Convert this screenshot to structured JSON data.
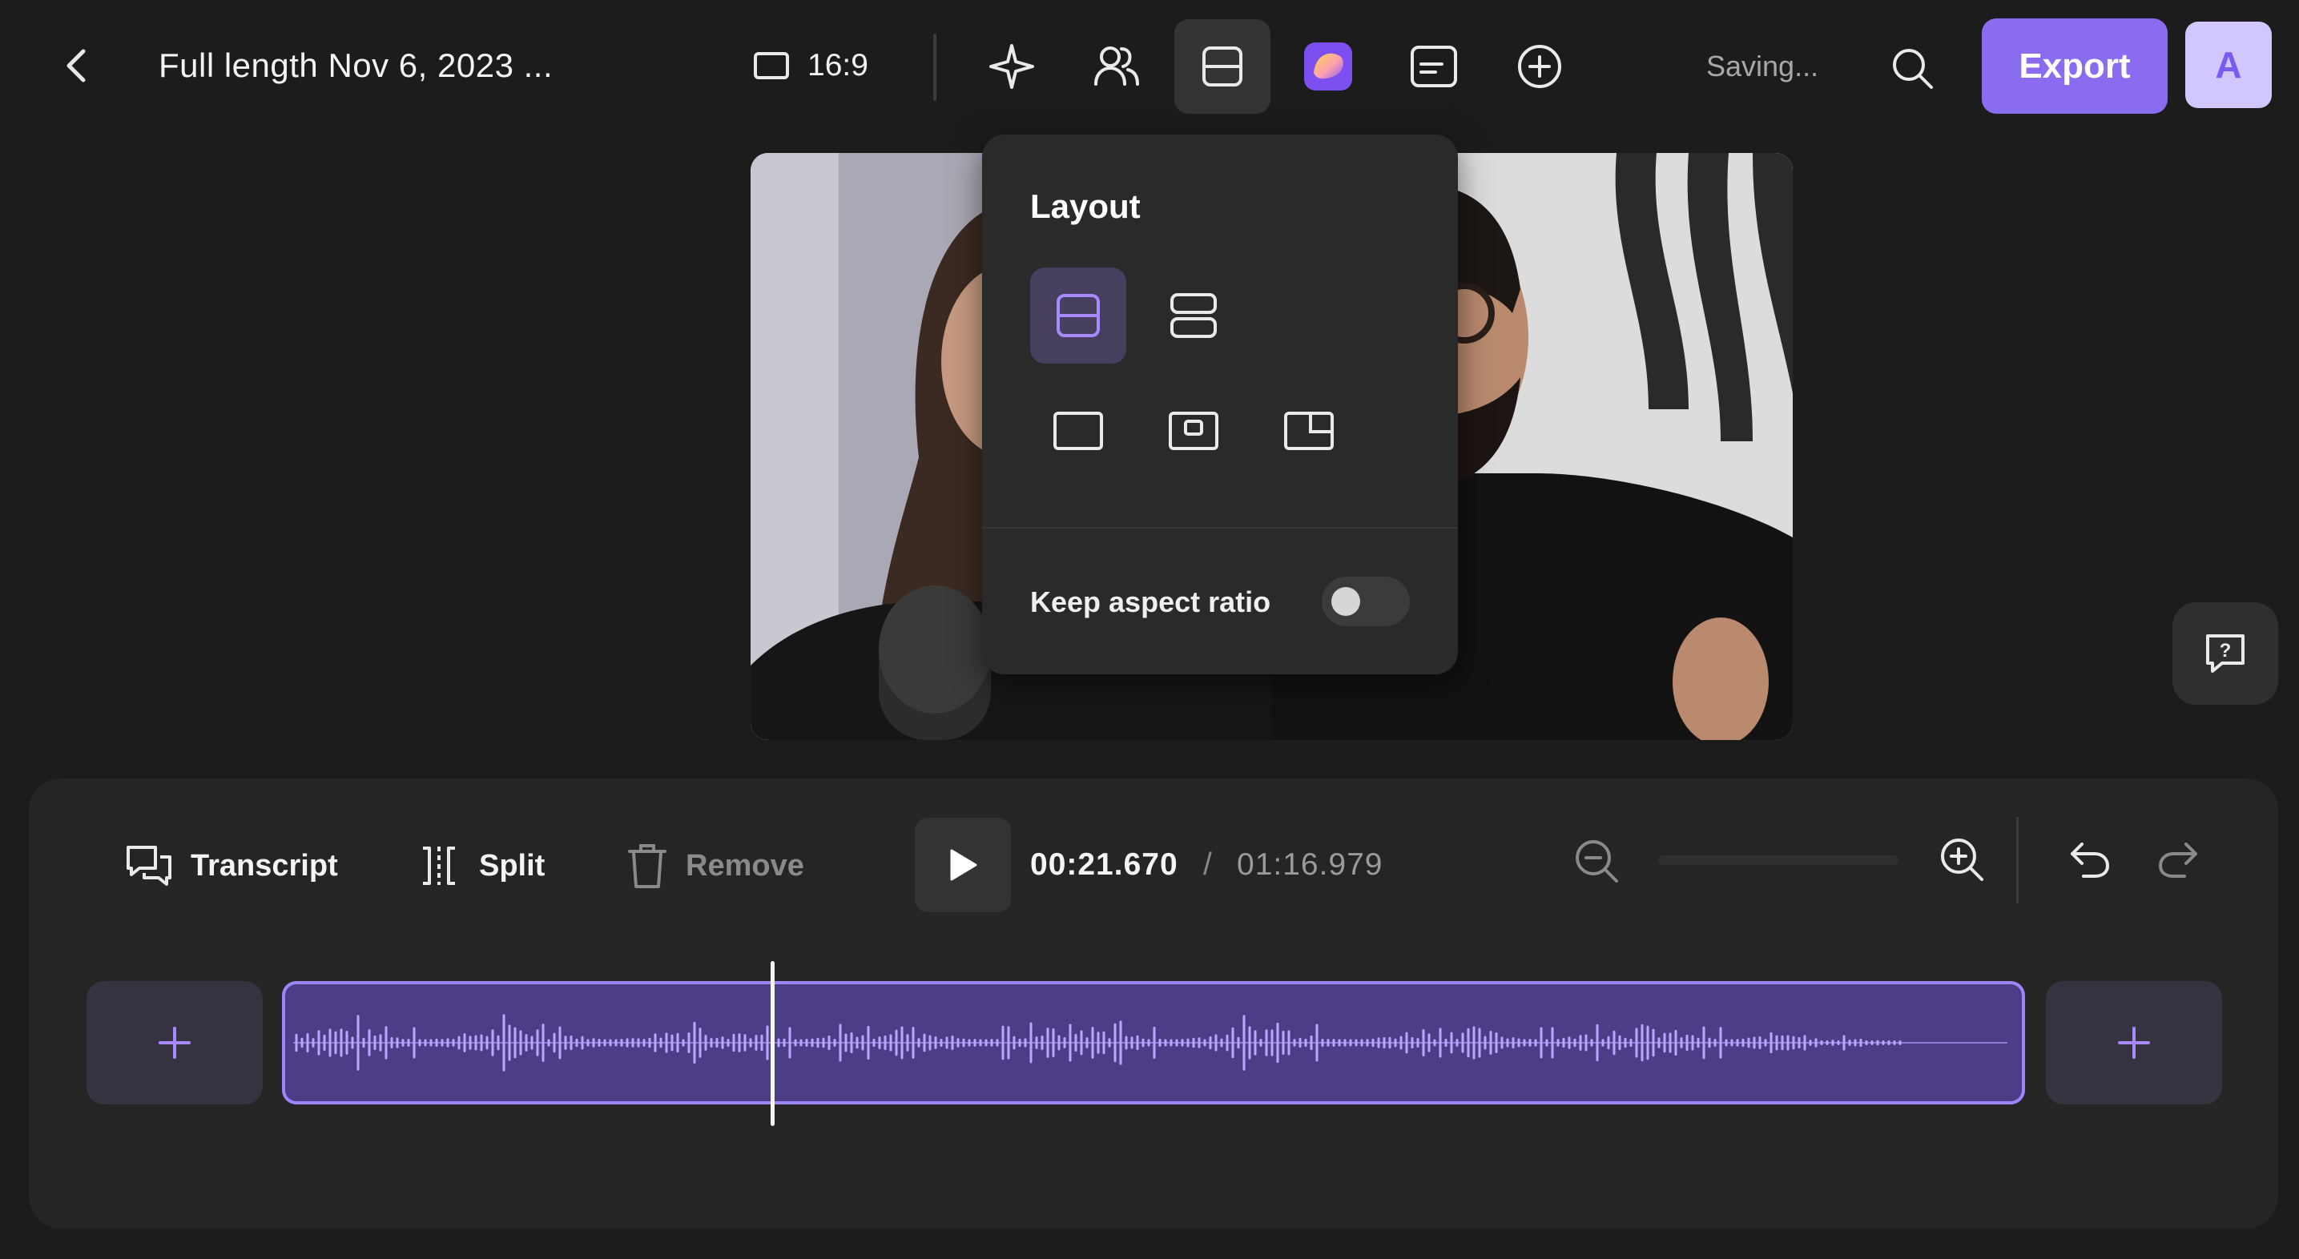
{
  "header": {
    "back_label": "",
    "project_title": "Full length Nov 6, 2023 ...",
    "aspect_ratio": "16:9",
    "saving_status": "Saving...",
    "export_label": "Export",
    "avatar_initial": "A",
    "toolbar_icons": [
      "sparkle-icon",
      "speakers-icon",
      "layout-icon",
      "brand-color-icon",
      "captions-icon",
      "add-icon"
    ],
    "active_tool": "layout"
  },
  "layout_popover": {
    "title": "Layout",
    "options": [
      "split-horizontal",
      "stacked",
      "single",
      "picture-in-picture",
      "corner-overlay"
    ],
    "selected": "split-horizontal",
    "keep_aspect_label": "Keep aspect ratio",
    "keep_aspect_on": false
  },
  "timeline": {
    "transcript_label": "Transcript",
    "split_label": "Split",
    "remove_label": "Remove",
    "current_time": "00:21.670",
    "separator": "/",
    "total_time": "01:16.979",
    "playhead_fraction": 0.2815
  },
  "colors": {
    "accent": "#8a6cf0",
    "clip_fill": "#4d3d86",
    "clip_border": "#9f84ff",
    "background": "#1c1c1c"
  }
}
